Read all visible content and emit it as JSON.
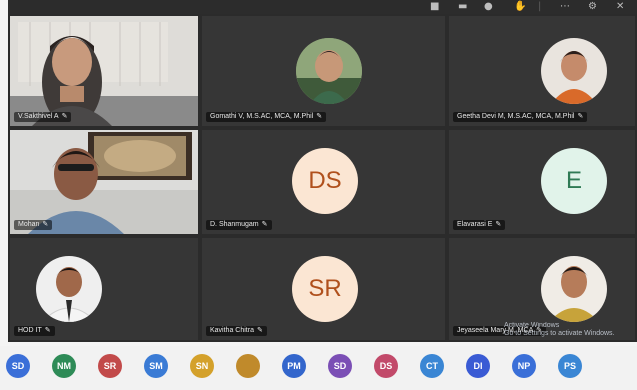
{
  "tiles": [
    {
      "name": "V.Sakthivel A",
      "initials": ""
    },
    {
      "name": "Gomathi V, M.S.AC, MCA, M.Phil",
      "initials": ""
    },
    {
      "name": "Geetha Devi M, M.S.AC, MCA, M.Phil",
      "initials": ""
    },
    {
      "name": "Mohan",
      "initials": ""
    },
    {
      "name": "D. Shanmugam",
      "initials": "DS"
    },
    {
      "name": "Elavarasi E",
      "initials": "E"
    },
    {
      "name": "HOD IT",
      "initials": ""
    },
    {
      "name": "Kavitha Chitra",
      "initials": "SR"
    },
    {
      "name": "Jeyaseela Mary M, MCA",
      "initials": ""
    }
  ],
  "strip": [
    {
      "label": "SD",
      "color": "#3b6fd8"
    },
    {
      "label": "NM",
      "color": "#2e8b57"
    },
    {
      "label": "SR",
      "color": "#c24a4a"
    },
    {
      "label": "SM",
      "color": "#3a7bd5"
    },
    {
      "label": "SN",
      "color": "#d4a12b"
    },
    {
      "label": "",
      "color": "#c08a2b"
    },
    {
      "label": "PM",
      "color": "#3366cc"
    },
    {
      "label": "SD",
      "color": "#7b4fb5"
    },
    {
      "label": "DS",
      "color": "#c24a6a"
    },
    {
      "label": "CT",
      "color": "#3a86d4"
    },
    {
      "label": "DI",
      "color": "#3a5bd4"
    },
    {
      "label": "NP",
      "color": "#3a6fd8"
    },
    {
      "label": "PS",
      "color": "#3a86d4"
    }
  ],
  "watermark": {
    "line1": "Activate Windows",
    "line2": "Go to Settings to activate Windows."
  },
  "colors": {
    "initials_bg": "#fbe6d3",
    "initials_text": "#b0501c",
    "initials_alt_bg": "#e1f3ea",
    "initials_alt_text": "#2f7a55"
  }
}
